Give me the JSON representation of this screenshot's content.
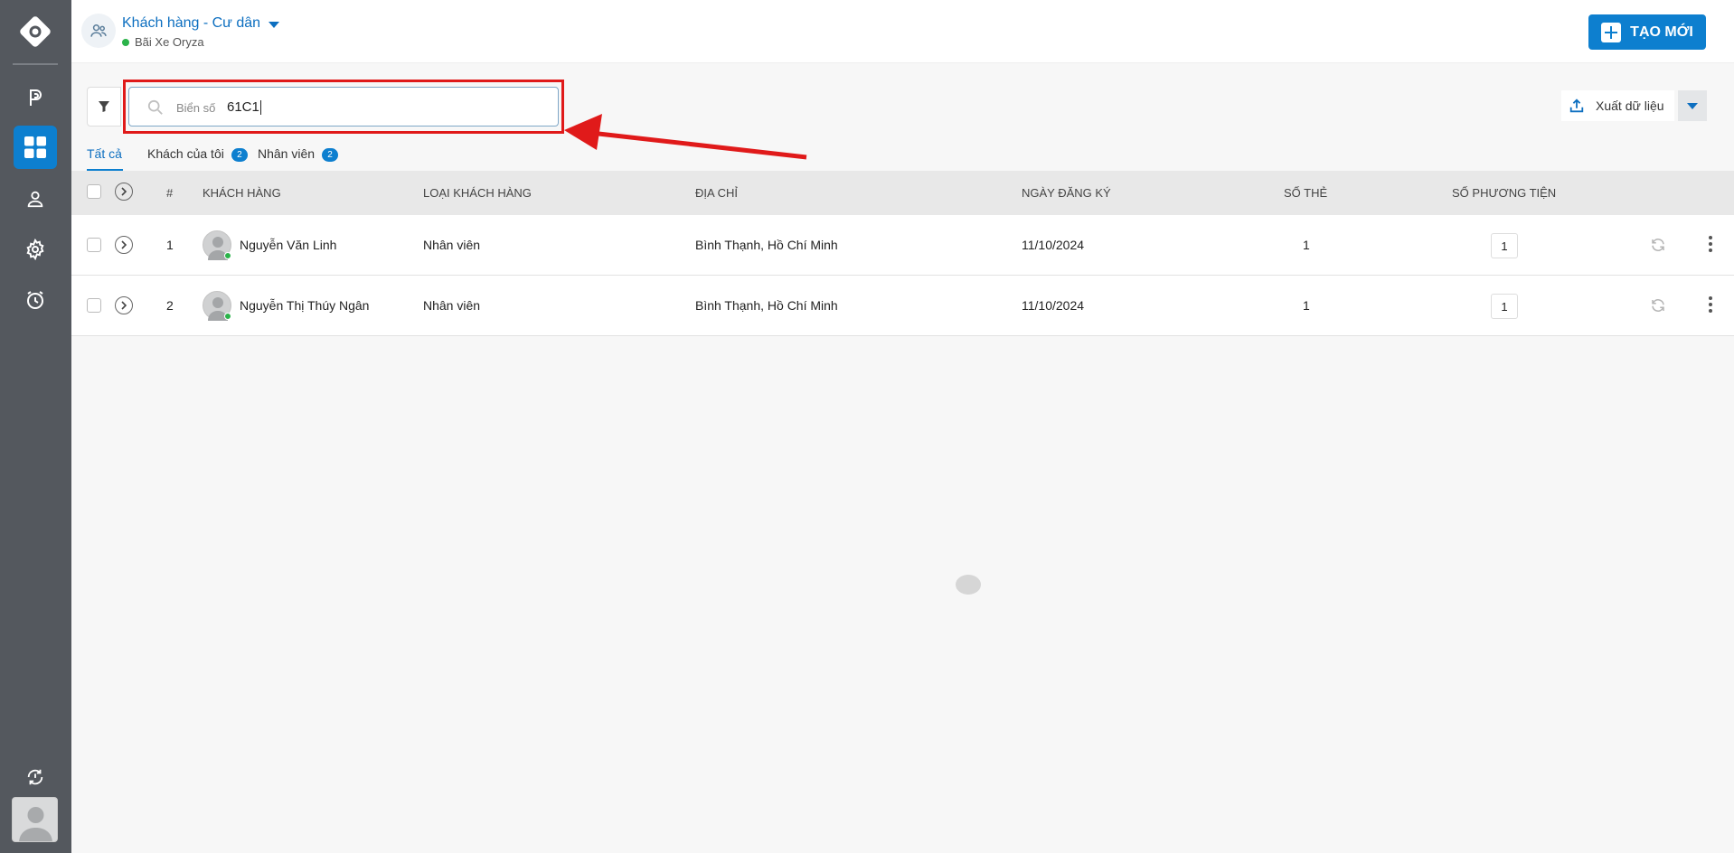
{
  "header": {
    "title": "Khách hàng - Cư dân",
    "subtitle": "Bãi Xe Oryza",
    "create_label": "TẠO MỚI"
  },
  "search": {
    "placeholder": "Biển số",
    "value": "61C1"
  },
  "export": {
    "label": "Xuất dữ liệu"
  },
  "tabs": [
    {
      "label": "Tất cả",
      "active": true
    },
    {
      "label": "Khách của tôi",
      "count": "2"
    },
    {
      "label": "Nhân viên",
      "count": "2"
    }
  ],
  "table": {
    "columns": [
      "#",
      "KHÁCH HÀNG",
      "LOẠI KHÁCH HÀNG",
      "ĐỊA CHỈ",
      "NGÀY ĐĂNG KÝ",
      "SỐ THẺ",
      "SỐ PHƯƠNG TIỆN"
    ],
    "rows": [
      {
        "index": "1",
        "name": "Nguyễn Văn Linh",
        "type": "Nhân viên",
        "address": "Bình Thạnh, Hồ Chí Minh",
        "date": "11/10/2024",
        "cards": "1",
        "vehicles": "1"
      },
      {
        "index": "2",
        "name": "Nguyễn Thị Thúy Ngân",
        "type": "Nhân viên",
        "address": "Bình Thạnh, Hồ Chí Minh",
        "date": "11/10/2024",
        "cards": "1",
        "vehicles": "1"
      }
    ]
  },
  "colors": {
    "accent": "#0d7fcf",
    "sidebar": "#54585e",
    "annotation": "#e01a1a",
    "online": "#2bb34a"
  }
}
